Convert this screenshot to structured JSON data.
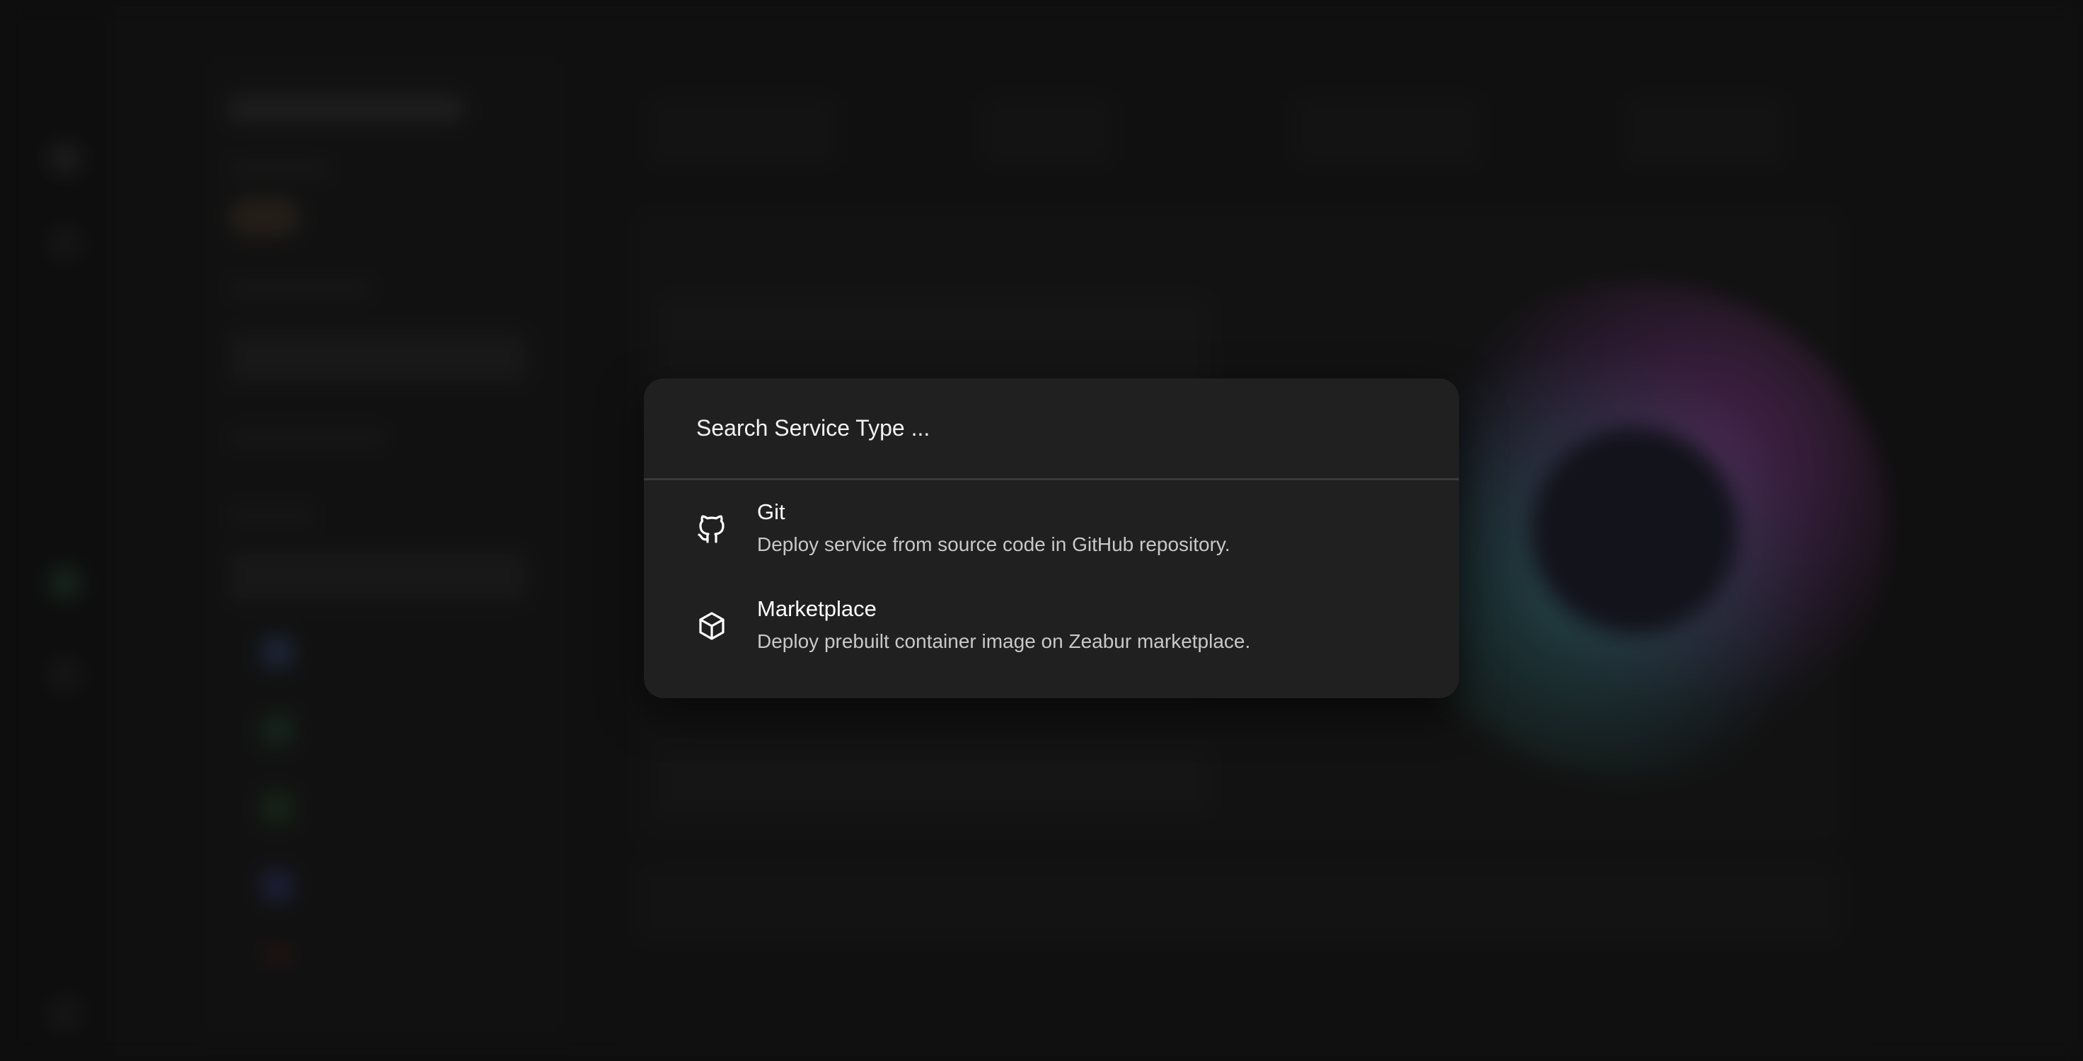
{
  "search": {
    "placeholder": "Search Service Type ..."
  },
  "options": [
    {
      "icon": "github-icon",
      "title": "Git",
      "description": "Deploy service from source code in GitHub repository."
    },
    {
      "icon": "cube-icon",
      "title": "Marketplace",
      "description": "Deploy prebuilt container image on Zeabur marketplace."
    }
  ],
  "colors": {
    "modal_background": "#202020",
    "divider": "#3a3a3a",
    "description_text": "#c8c8c8"
  }
}
